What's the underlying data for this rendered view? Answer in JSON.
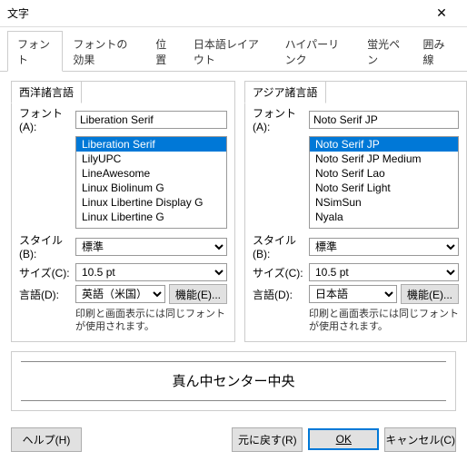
{
  "window": {
    "title": "文字"
  },
  "tabs": [
    "フォント",
    "フォントの効果",
    "位置",
    "日本語レイアウト",
    "ハイパーリンク",
    "蛍光ペン",
    "囲み線"
  ],
  "active_tab": 0,
  "west": {
    "group_title": "西洋諸言語",
    "font_label": "フォント(A):",
    "font_value": "Liberation Serif",
    "font_list": [
      "Liberation Serif",
      "LilyUPC",
      "LineAwesome",
      "Linux Biolinum G",
      "Linux Libertine Display G",
      "Linux Libertine G"
    ],
    "font_selected": "Liberation Serif",
    "style_label": "スタイル(B):",
    "style_value": "標準",
    "size_label": "サイズ(C):",
    "size_value": "10.5 pt",
    "lang_label": "言語(D):",
    "lang_value": "英語（米国）",
    "feature_btn": "機能(E)...",
    "note": "印刷と画面表示には同じフォントが使用されます。"
  },
  "east": {
    "group_title": "アジア諸言語",
    "font_label": "フォント(A):",
    "font_value": "Noto Serif JP",
    "font_list": [
      "Noto Serif JP",
      "Noto Serif JP Medium",
      "Noto Serif Lao",
      "Noto Serif Light",
      "NSimSun",
      "Nyala"
    ],
    "font_selected": "Noto Serif JP",
    "style_label": "スタイル(B):",
    "style_value": "標準",
    "size_label": "サイズ(C):",
    "size_value": "10.5 pt",
    "lang_label": "言語(D):",
    "lang_value": "日本語",
    "feature_btn": "機能(E)...",
    "note": "印刷と画面表示には同じフォントが使用されます。"
  },
  "preview": "真ん中センター中央",
  "footer": {
    "help": "ヘルプ(H)",
    "reset": "元に戻す(R)",
    "ok": "OK",
    "cancel": "キャンセル(C)"
  }
}
